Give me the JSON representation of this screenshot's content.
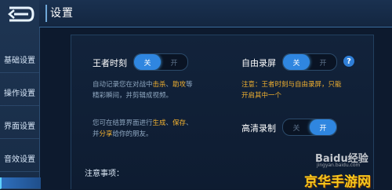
{
  "window": {
    "title": "设置"
  },
  "sidebar": {
    "items": [
      {
        "label": "基础设置"
      },
      {
        "label": "操作设置"
      },
      {
        "label": "界面设置"
      },
      {
        "label": "音效设置"
      }
    ]
  },
  "settings": {
    "king_moment": {
      "label": "王者时刻",
      "off_label": "关",
      "on_label": "开",
      "state": "off",
      "desc_lines": [
        [
          "自动记录您在对战中",
          "击杀",
          "、",
          "助攻",
          "等"
        ],
        [
          "精彩瞬间，并剪辑成视频。"
        ]
      ],
      "desc2_lines": [
        [
          "您可在结算界面进行",
          "生成",
          "、",
          "保存",
          "、"
        ],
        [
          "并",
          "分享",
          "给你的朋友。"
        ]
      ]
    },
    "free_record": {
      "label": "自由录屏",
      "off_label": "关",
      "on_label": "开",
      "state": "off",
      "note_line1": "注意：王者时刻与自由录屏，只能",
      "note_line2": "开启其中一个"
    },
    "hd_record": {
      "label": "高清录制",
      "off_label": "关",
      "on_label": "开",
      "state": "on"
    },
    "notes": {
      "title": "注意事项："
    }
  },
  "watermarks": {
    "baidu": "Baidu经验",
    "baidu_sub": "jingyan.baidu.com",
    "site": "京华手游网"
  },
  "colors": {
    "accent": "#2f86e0",
    "highlight": "#f0b030"
  }
}
